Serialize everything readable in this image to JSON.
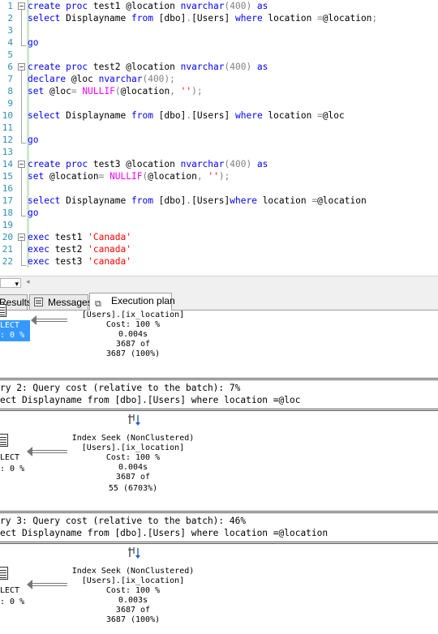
{
  "editor": {
    "line_numbers": [
      "1",
      "2",
      "3",
      "4",
      "5",
      "6",
      "7",
      "8",
      "9",
      "10",
      "11",
      "12",
      "13",
      "14",
      "15",
      "16",
      "17",
      "18",
      "19",
      "20",
      "21",
      "22"
    ],
    "lines": [
      [
        {
          "t": "create proc",
          "c": "kw"
        },
        {
          "t": " test1 @location ",
          "c": ""
        },
        {
          "t": "nvarchar",
          "c": "kw"
        },
        {
          "t": "(400) ",
          "c": "gray"
        },
        {
          "t": "as",
          "c": "kw"
        }
      ],
      [
        {
          "t": "select",
          "c": "kw"
        },
        {
          "t": " Displayname ",
          "c": ""
        },
        {
          "t": "from",
          "c": "kw"
        },
        {
          "t": " [dbo]",
          "c": ""
        },
        {
          "t": ".",
          "c": "gray"
        },
        {
          "t": "[Users] ",
          "c": ""
        },
        {
          "t": "where",
          "c": "kw"
        },
        {
          "t": " location ",
          "c": ""
        },
        {
          "t": "=",
          "c": "gray"
        },
        {
          "t": "@location",
          "c": ""
        },
        {
          "t": ";",
          "c": "gray"
        }
      ],
      [],
      [
        {
          "t": "go",
          "c": "kw"
        }
      ],
      [],
      [
        {
          "t": "create proc",
          "c": "kw"
        },
        {
          "t": " test2 @location ",
          "c": ""
        },
        {
          "t": "nvarchar",
          "c": "kw"
        },
        {
          "t": "(400) ",
          "c": "gray"
        },
        {
          "t": "as",
          "c": "kw"
        }
      ],
      [
        {
          "t": "declare",
          "c": "kw"
        },
        {
          "t": " @loc ",
          "c": ""
        },
        {
          "t": "nvarchar",
          "c": "kw"
        },
        {
          "t": "(400);",
          "c": "gray"
        }
      ],
      [
        {
          "t": "set",
          "c": "kw"
        },
        {
          "t": " @loc",
          "c": ""
        },
        {
          "t": "= ",
          "c": "gray"
        },
        {
          "t": "NULLIF",
          "c": "fn"
        },
        {
          "t": "(",
          "c": "gray"
        },
        {
          "t": "@location",
          "c": ""
        },
        {
          "t": ", ",
          "c": "gray"
        },
        {
          "t": "''",
          "c": "str"
        },
        {
          "t": ");",
          "c": "gray"
        }
      ],
      [],
      [
        {
          "t": "select",
          "c": "kw"
        },
        {
          "t": " Displayname ",
          "c": ""
        },
        {
          "t": "from",
          "c": "kw"
        },
        {
          "t": " [dbo]",
          "c": ""
        },
        {
          "t": ".",
          "c": "gray"
        },
        {
          "t": "[Users] ",
          "c": ""
        },
        {
          "t": "where",
          "c": "kw"
        },
        {
          "t": " location ",
          "c": ""
        },
        {
          "t": "=",
          "c": "gray"
        },
        {
          "t": "@loc",
          "c": ""
        }
      ],
      [],
      [
        {
          "t": "go",
          "c": "kw"
        }
      ],
      [],
      [
        {
          "t": "create proc",
          "c": "kw"
        },
        {
          "t": " test3 @location ",
          "c": ""
        },
        {
          "t": "nvarchar",
          "c": "kw"
        },
        {
          "t": "(400) ",
          "c": "gray"
        },
        {
          "t": "as",
          "c": "kw"
        }
      ],
      [
        {
          "t": "set",
          "c": "kw"
        },
        {
          "t": " @location",
          "c": ""
        },
        {
          "t": "= ",
          "c": "gray"
        },
        {
          "t": "NULLIF",
          "c": "fn"
        },
        {
          "t": "(",
          "c": "gray"
        },
        {
          "t": "@location",
          "c": ""
        },
        {
          "t": ", ",
          "c": "gray"
        },
        {
          "t": "''",
          "c": "str"
        },
        {
          "t": ");",
          "c": "gray"
        }
      ],
      [],
      [
        {
          "t": "select",
          "c": "kw"
        },
        {
          "t": " Displayname ",
          "c": ""
        },
        {
          "t": "from",
          "c": "kw"
        },
        {
          "t": " [dbo]",
          "c": ""
        },
        {
          "t": ".",
          "c": "gray"
        },
        {
          "t": "[Users]",
          "c": ""
        },
        {
          "t": "where",
          "c": "kw"
        },
        {
          "t": " location ",
          "c": ""
        },
        {
          "t": "=",
          "c": "gray"
        },
        {
          "t": "@location",
          "c": ""
        }
      ],
      [
        {
          "t": "go",
          "c": "kw"
        }
      ],
      [],
      [
        {
          "t": "exec",
          "c": "kw"
        },
        {
          "t": " test1 ",
          "c": ""
        },
        {
          "t": "'Canada'",
          "c": "str"
        }
      ],
      [
        {
          "t": "exec",
          "c": "kw"
        },
        {
          "t": " test2 ",
          "c": ""
        },
        {
          "t": "'canada'",
          "c": "str"
        }
      ],
      [
        {
          "t": "exec",
          "c": "kw"
        },
        {
          "t": " test3 ",
          "c": ""
        },
        {
          "t": "'canada'",
          "c": "str"
        }
      ]
    ]
  },
  "scrollbar": {
    "zoom": ""
  },
  "tabs": [
    {
      "label": "Results",
      "icon": "grid-icon"
    },
    {
      "label": "Messages",
      "icon": "messages-icon"
    },
    {
      "label": "Execution plan",
      "icon": "execution-plan-icon"
    }
  ],
  "plan": {
    "q1": {
      "select_label": "LECT",
      "select_cost": ": 0 %",
      "seek_lines": [
        "[Users].[ix_location]",
        "Cost: 100 %",
        "0.004s",
        "3687 of",
        "3687 (100%)"
      ]
    },
    "q2": {
      "header": "ry 2: Query cost (relative to the batch): 7%",
      "statement": "ect Displayname from [dbo].[Users] where location =@loc",
      "select_label": "LECT",
      "select_cost": ": 0 %",
      "seek_lines": [
        "Index Seek (NonClustered)",
        "[Users].[ix_location]",
        "Cost: 100 %",
        "0.004s",
        "3687 of",
        "55 (6703%)"
      ]
    },
    "q3": {
      "header": "ry 3: Query cost (relative to the batch): 46%",
      "statement": "ect Displayname from [dbo].[Users] where location =@location",
      "select_label": "LECT",
      "select_cost": ": 0 %",
      "seek_lines": [
        "Index Seek (NonClustered)",
        "[Users].[ix_location]",
        "Cost: 100 %",
        "0.003s",
        "3687 of",
        "3687 (100%)"
      ]
    }
  }
}
